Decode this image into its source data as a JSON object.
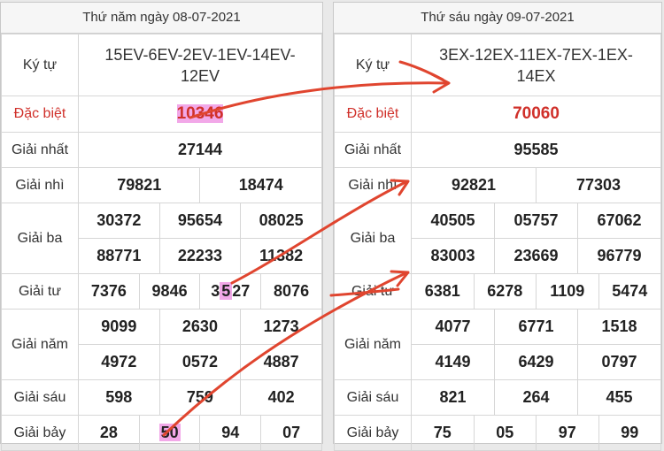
{
  "left": {
    "date": "Thứ năm ngày 08-07-2021",
    "labels": {
      "kytu": "Ký tự",
      "db": "Đặc biệt",
      "g1": "Giải nhất",
      "g2": "Giải nhì",
      "g3": "Giải ba",
      "g4": "Giải tư",
      "g5": "Giải năm",
      "g6": "Giải sáu",
      "g7": "Giải bảy"
    },
    "code_line1": "15EV-6EV-2EV-1EV-14EV-",
    "code_line2": "12EV",
    "db": "10346",
    "g1": "27144",
    "g2": [
      "79821",
      "18474"
    ],
    "g3": [
      "30372",
      "95654",
      "08025",
      "88771",
      "22233",
      "11382"
    ],
    "g4": [
      "7376",
      "9846",
      "3527",
      "8076"
    ],
    "g5": [
      "9099",
      "2630",
      "1273",
      "4972",
      "0572",
      "4887"
    ],
    "g6": [
      "598",
      "759",
      "402"
    ],
    "g7": [
      "28",
      "50",
      "94",
      "07"
    ]
  },
  "right": {
    "date": "Thứ sáu ngày 09-07-2021",
    "labels": {
      "kytu": "Ký tự",
      "db": "Đặc biệt",
      "g1": "Giải nhất",
      "g2": "Giải nhì",
      "g3": "Giải ba",
      "g4": "Giải tư",
      "g5": "Giải năm",
      "g6": "Giải sáu",
      "g7": "Giải bảy"
    },
    "code_line1": "3EX-12EX-11EX-7EX-1EX-",
    "code_line2": "14EX",
    "db": "70060",
    "g1": "95585",
    "g2": [
      "92821",
      "77303"
    ],
    "g3": [
      "40505",
      "05757",
      "67062",
      "83003",
      "23669",
      "96779"
    ],
    "g4": [
      "6381",
      "6278",
      "1109",
      "5474"
    ],
    "g5": [
      "4077",
      "6771",
      "1518",
      "4149",
      "6429",
      "0797"
    ],
    "g6": [
      "821",
      "264",
      "455"
    ],
    "g7": [
      "75",
      "05",
      "97",
      "99"
    ]
  },
  "colors": {
    "special": "#d0302a",
    "highlight": "#f2a8e8",
    "arrow": "#e0452f"
  }
}
